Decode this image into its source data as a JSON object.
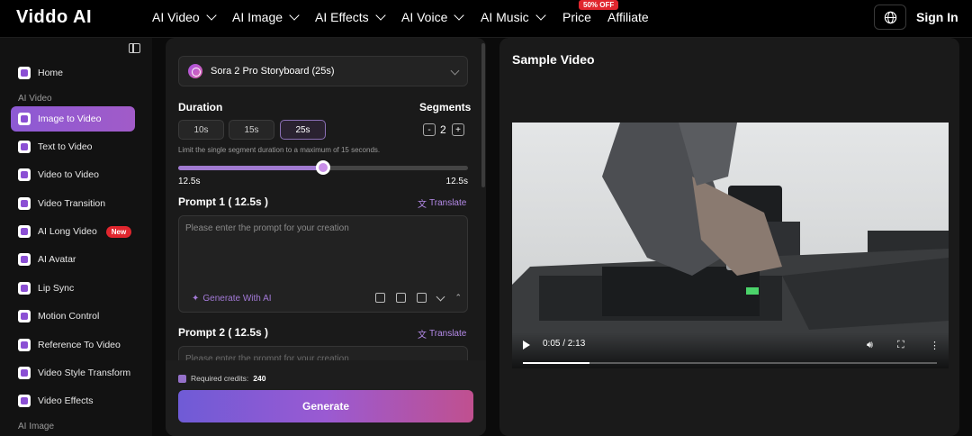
{
  "brand": {
    "name": "Viddo AI"
  },
  "nav": {
    "items": [
      {
        "label": "AI Video",
        "has_dropdown": true
      },
      {
        "label": "AI Image",
        "has_dropdown": true
      },
      {
        "label": "AI Effects",
        "has_dropdown": true
      },
      {
        "label": "AI Voice",
        "has_dropdown": true
      },
      {
        "label": "AI Music",
        "has_dropdown": true
      },
      {
        "label": "Price",
        "has_dropdown": false
      },
      {
        "label": "Affiliate",
        "has_dropdown": false
      }
    ],
    "price_badge": "50% OFF",
    "signin": "Sign In"
  },
  "sidebar": {
    "home": "Home",
    "group_video": "AI Video",
    "group_image": "AI Image",
    "items": [
      {
        "label": "Image to Video",
        "active": true
      },
      {
        "label": "Text to Video"
      },
      {
        "label": "Video to Video"
      },
      {
        "label": "Video Transition"
      },
      {
        "label": "AI Long Video",
        "badge": "New"
      },
      {
        "label": "AI Avatar"
      },
      {
        "label": "Lip Sync"
      },
      {
        "label": "Motion Control"
      },
      {
        "label": "Reference To Video"
      },
      {
        "label": "Video Style Transform"
      },
      {
        "label": "Video Effects"
      }
    ]
  },
  "form": {
    "model": "Sora 2 Pro Storyboard (25s)",
    "duration_label": "Duration",
    "duration_options": [
      "10s",
      "15s",
      "25s"
    ],
    "duration_selected": "25s",
    "segments_label": "Segments",
    "segments_value": "2",
    "segments_minus": "-",
    "segments_plus": "+",
    "hint": "Limit the single segment duration to a maximum of 15 seconds.",
    "slider_fraction": 0.5,
    "slider_left": "12.5s",
    "slider_right": "12.5s",
    "prompt1_label": "Prompt 1 ( 12.5s )",
    "prompt2_label": "Prompt 2 ( 12.5s )",
    "translate": "Translate",
    "prompt_placeholder": "Please enter the prompt for your creation",
    "generate_with_ai": "Generate With AI",
    "credits_label": "Required credits:",
    "credits_value": "240",
    "generate": "Generate"
  },
  "sample": {
    "title": "Sample Video",
    "time": "0:05 / 2:13",
    "progress_fraction": 0.16
  },
  "colors": {
    "accent": "#9b5bd4",
    "badge_red": "#e0262e"
  }
}
